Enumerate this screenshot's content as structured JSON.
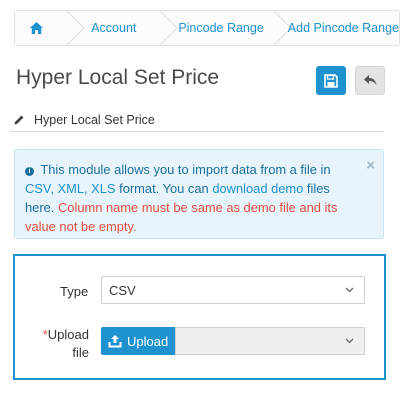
{
  "breadcrumb": {
    "home_icon": "home-icon",
    "items": [
      {
        "label": "Account"
      },
      {
        "label": "Pincode Range"
      },
      {
        "label": "Add Pincode Range"
      }
    ]
  },
  "header": {
    "title": "Hyper Local Set Price",
    "save_icon": "save-icon",
    "back_icon": "back-arrow-icon"
  },
  "panel": {
    "heading": "Hyper Local Set Price",
    "heading_icon": "pencil-icon"
  },
  "alert": {
    "icon": "info-icon",
    "text_intro": "This module allows you to import data from a file in",
    "formats": "CSV, XML, XLS",
    "text_format": "format. You can",
    "link": "download demo",
    "text_files": "files here.",
    "warning": "Column name must be same as demo file and its value not be empty.",
    "close": "×"
  },
  "form": {
    "type_label": "Type",
    "type_value": "CSV",
    "upload_required": "*",
    "upload_label_1": "Upload",
    "upload_label_2": "file",
    "upload_button": "Upload",
    "upload_value": ""
  },
  "colors": {
    "primary": "#1e91cf",
    "danger": "#e3503e",
    "alert_bg": "#e8f4fb"
  }
}
